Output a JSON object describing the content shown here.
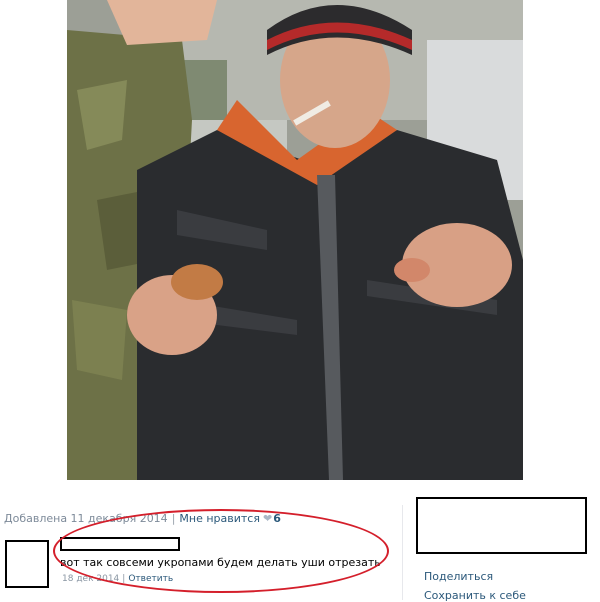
{
  "post": {
    "added_label": "Добавлена 11 декабря 2014",
    "separator": "|",
    "like_label": "Мне нравится",
    "like_icon": "heart-icon",
    "like_count": "6"
  },
  "comment": {
    "text": "вот так совсеми укропами будем делать уши отрезать",
    "date": "18 дек 2014",
    "separator": "|",
    "reply_label": "Ответить"
  },
  "actions": {
    "share_label": "Поделиться",
    "save_label": "Сохранить к себе"
  },
  "colors": {
    "link": "#2b587a",
    "meta_gray": "#7d8a99",
    "highlight_ellipse": "#d41f2b"
  }
}
